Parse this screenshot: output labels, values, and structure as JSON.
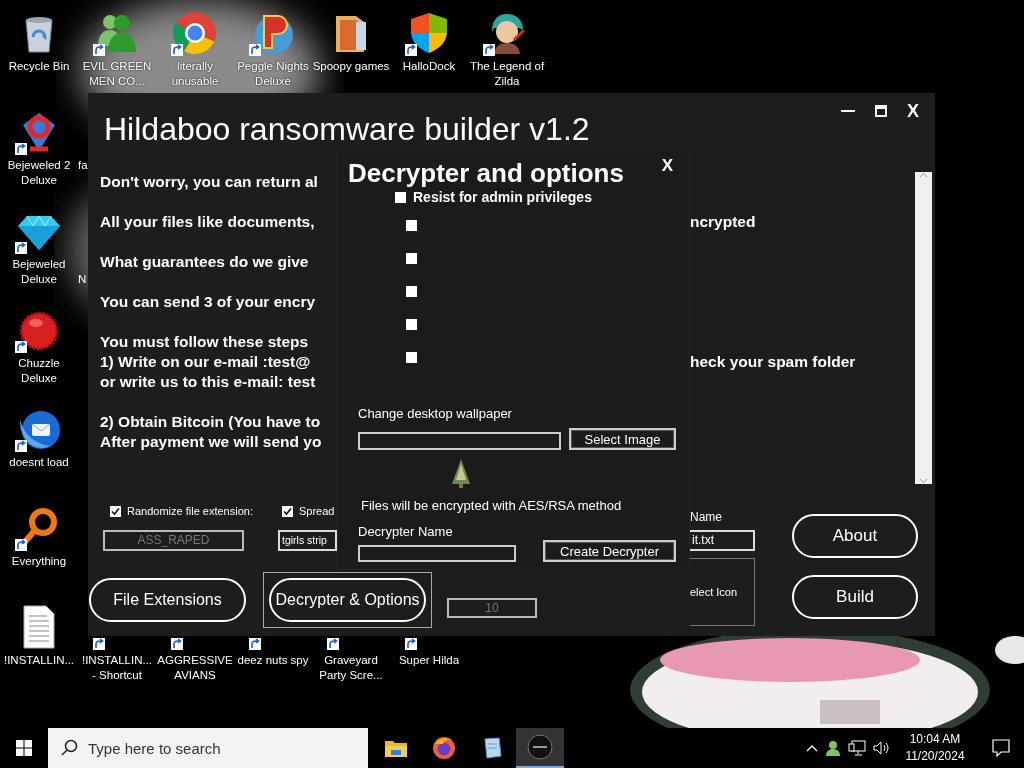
{
  "desktop": {
    "top_row": [
      {
        "label": "Recycle Bin",
        "shortcut": false
      },
      {
        "label": "EVIL GREEN MEN CO...",
        "shortcut": true
      },
      {
        "label": "literally unusable",
        "shortcut": true
      },
      {
        "label": "Peggle Nights Deluxe",
        "shortcut": true
      },
      {
        "label": "Spoopy games",
        "shortcut": false
      },
      {
        "label": "HalloDock",
        "shortcut": true
      },
      {
        "label": "The Legend of Zilda",
        "shortcut": true
      }
    ],
    "left_column": [
      {
        "label": "Bejeweled 2 Deluxe",
        "shortcut": true
      },
      {
        "label": "Bejeweled Deluxe",
        "shortcut": true
      },
      {
        "label": "Chuzzle Deluxe",
        "shortcut": true
      },
      {
        "label": "doesnt load",
        "shortcut": true
      },
      {
        "label": "Everything",
        "shortcut": true
      }
    ],
    "covered_labels": [
      "fa",
      "N"
    ],
    "bottom_row": [
      {
        "label": "!INSTALLIN...",
        "shortcut": false
      },
      {
        "label": "!INSTALLIN... - Shortcut",
        "shortcut": true
      },
      {
        "label": "AGGRESSIVE AVIANS",
        "shortcut": true
      },
      {
        "label": "deez nuts spy",
        "shortcut": true
      },
      {
        "label": "Graveyard Party Scre...",
        "shortcut": true
      },
      {
        "label": "Super Hilda",
        "shortcut": true
      }
    ]
  },
  "builder_window": {
    "title": "Hildaboo ransomware builder v1.2",
    "close": "X",
    "message": [
      {
        "lines": [
          {
            "left": "Don't worry, you can return al"
          }
        ]
      },
      {
        "lines": [
          {
            "left": "All your files like documents,",
            "right": "ncrypted"
          }
        ]
      },
      {
        "lines": [
          {
            "left": "What guarantees do we give"
          }
        ]
      },
      {
        "lines": [
          {
            "left": "You can send 3 of your encry"
          }
        ]
      },
      {
        "lines": [
          {
            "left": "You must follow these steps"
          },
          {
            "left": "1) Write on our e-mail :test@",
            "right": "heck your spam folder"
          },
          {
            "left": "or write us to this e-mail: test"
          }
        ]
      },
      {
        "lines": [
          {
            "left": "2) Obtain Bitcoin (You have to"
          },
          {
            "left": "After payment we will send yo"
          }
        ]
      }
    ],
    "options": [
      {
        "label": "Randomize file extension:",
        "checked": true,
        "value": "ASS_RAPED",
        "disabled": true
      },
      {
        "label": "Spread",
        "checked": true,
        "value": "tgirls strip",
        "disabled": false
      }
    ],
    "buttons": [
      {
        "label": "File Extensions",
        "selected": false
      },
      {
        "label": "Decrypter & Options",
        "selected": true
      }
    ],
    "count_field": {
      "value": "10",
      "disabled": true
    },
    "name_label": "Name",
    "name_value": "it.txt",
    "icon_picker": "elect Icon",
    "side_buttons": [
      "About",
      "Build"
    ]
  },
  "dialog": {
    "title": "Decrypter and options",
    "close": "X",
    "admin": {
      "label": "Resist for admin privileges",
      "checked": false
    },
    "faded_options": [
      {
        "checked": false
      },
      {
        "checked": false
      },
      {
        "checked": false
      },
      {
        "checked": false
      },
      {
        "checked": false
      }
    ],
    "wallpaper_label": "Change desktop wallpaper",
    "select_image": "Select Image",
    "method_note": "Files will be encrypted with AES/RSA method",
    "name_label": "Decrypter Name",
    "create_button": "Create Decrypter"
  },
  "taskbar": {
    "search_placeholder": "Type here to search",
    "apps": [
      {
        "selected": false
      },
      {
        "selected": false
      },
      {
        "selected": false
      },
      {
        "selected": true
      }
    ],
    "time": "10:04 AM",
    "date": "11/20/2024"
  }
}
